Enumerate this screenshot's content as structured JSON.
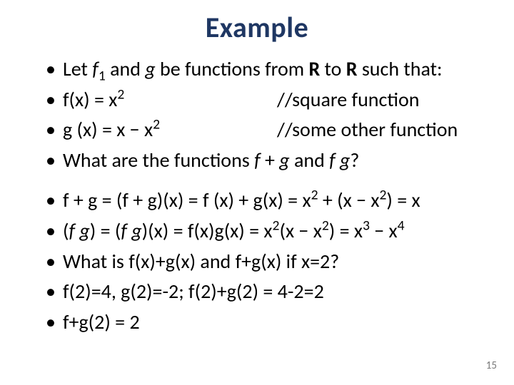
{
  "title": "Example",
  "group1": {
    "b1_pre": "Let ",
    "b1_f": "f",
    "b1_sub": "1",
    "b1_mid": " and ",
    "b1_g": "g",
    "b1_mid2": " be functions from ",
    "b1_R1": "R",
    "b1_to": " to ",
    "b1_R2": "R",
    "b1_end": " such that:",
    "b2_l": "f(x) = x",
    "b2_sup": "2",
    "b2_r": "//square function",
    "b3_l": "g (x) = x − x",
    "b3_sup": "2",
    "b3_r": "//some other function",
    "b4_a": "What are the functions ",
    "b4_f": "f ",
    "b4_plus": "+ ",
    "b4_g": "g",
    "b4_and": " and ",
    "b4_f2": "f g",
    "b4_q": "?"
  },
  "group2": {
    "b5_a": "f + g = (f + g)(x) = f (x) + g(x) = x",
    "b5_sup1": "2",
    "b5_b": " + (x − x",
    "b5_sup2": "2",
    "b5_c": ") = x",
    "b6_a": "(",
    "b6_fg": "f g",
    "b6_b": ") = (",
    "b6_fg2": "f g",
    "b6_c": ")(x) = f(x)g(x) = x",
    "b6_sup1": "2",
    "b6_d": "(x − x",
    "b6_sup2": "2",
    "b6_e": ") = x",
    "b6_sup3": "3",
    "b6_f": " − x",
    "b6_sup4": "4",
    "b7": "What is f(x)+g(x) and f+g(x) if x=2?",
    "b8": "f(2)=4, g(2)=-2; f(2)+g(2) = 4-2=2",
    "b9": " f+g(2) = 2"
  },
  "page": "15"
}
